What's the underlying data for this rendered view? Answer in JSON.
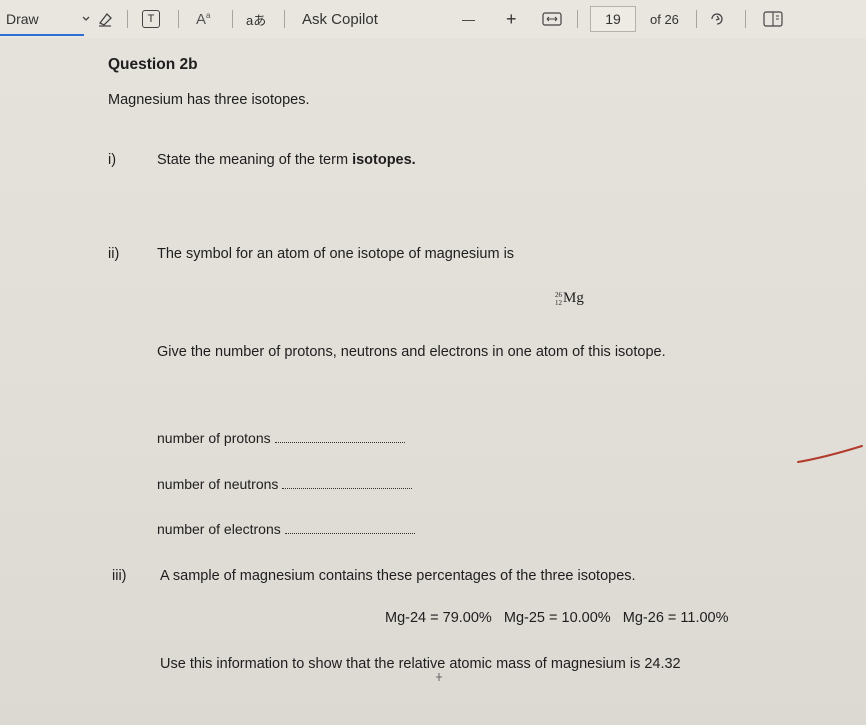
{
  "toolbar": {
    "draw_label": "Draw",
    "text_icon_glyph": "T",
    "font_size_glyph": "A",
    "translate_glyph": "aあ",
    "copilot_label": "Ask Copilot",
    "zoom_out": "—",
    "zoom_in": "+",
    "page_number": "19",
    "page_total": "of 26"
  },
  "document": {
    "heading": "Question 2b",
    "intro": "Magnesium has three isotopes.",
    "q1_num": "i)",
    "q1_text": "State the meaning of the term ",
    "q1_bold": "isotopes.",
    "q2_num": "ii)",
    "q2_text": "The symbol for an atom of one isotope of magnesium is",
    "symbol_mass": "26",
    "symbol_atomic": "12",
    "symbol_element": "Mg",
    "q2_instruction": "Give the number of protons, neutrons and electrons in one atom of this isotope.",
    "protons_label": "number of protons",
    "neutrons_label": "number of neutrons",
    "electrons_label": "number of electrons",
    "q3_num": "iii)",
    "q3_text": "A sample of magnesium contains these percentages of the three isotopes.",
    "percentages": "Mg-24 = 79.00%   Mg-25 = 10.00%   Mg-26 = 11.00%",
    "q3_instruction": "Use this information to show that the relative atomic mass of magnesium is 24.32"
  },
  "colors": {
    "accent": "#2d6fd6",
    "annotation": "#b23a2c"
  }
}
